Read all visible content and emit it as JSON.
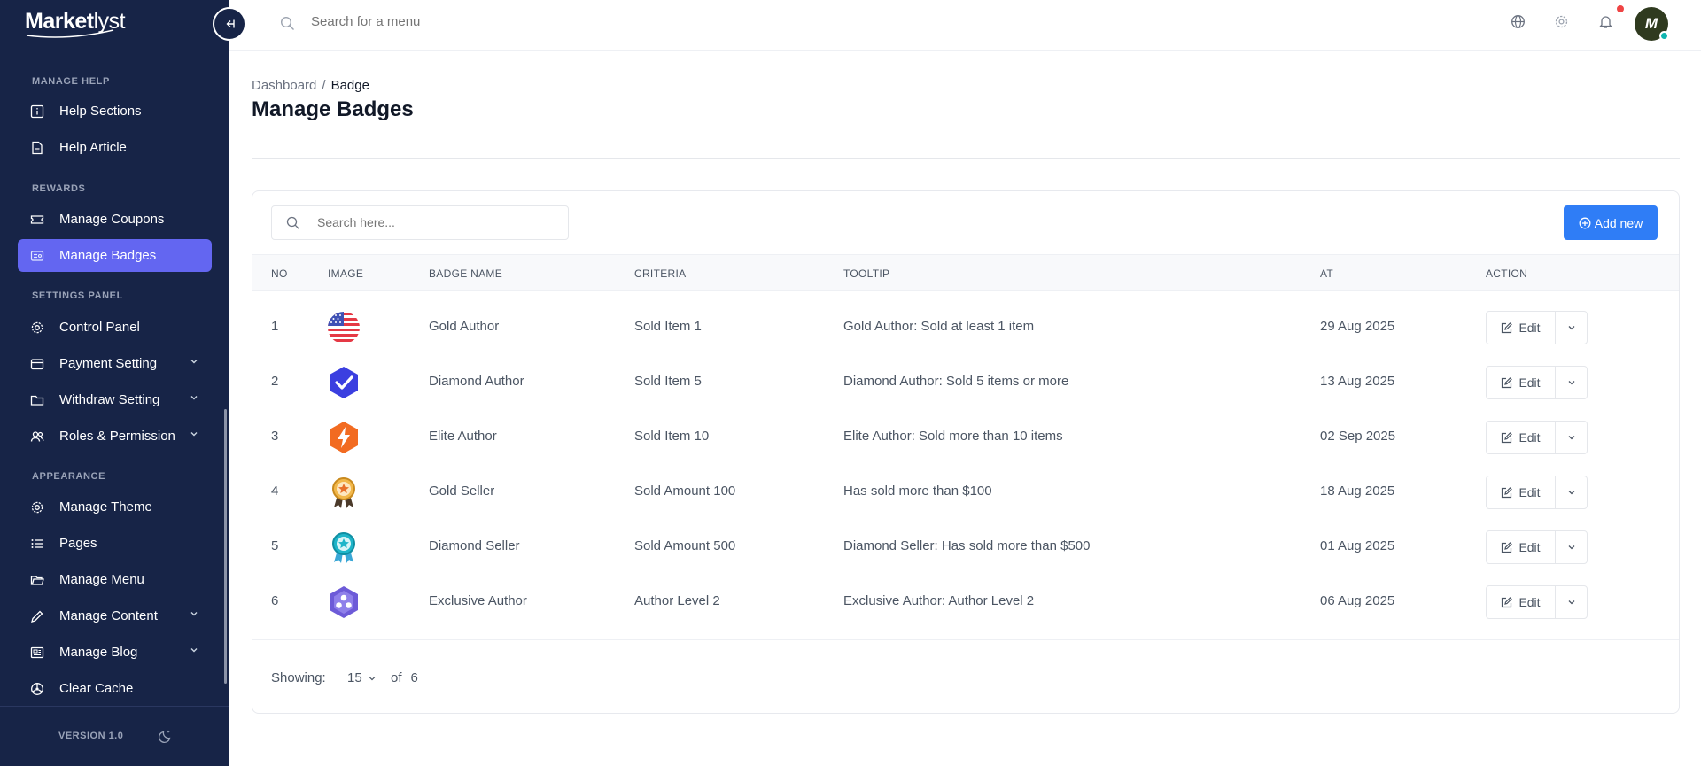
{
  "app": {
    "logo_bold": "Market",
    "logo_thin": "lyst"
  },
  "topbar": {
    "search_placeholder": "Search for a menu",
    "avatar_initial": "M"
  },
  "sidebar": {
    "sections": [
      {
        "title": "MANAGE HELP"
      },
      {
        "title": "REWARDS"
      },
      {
        "title": "SETTINGS PANEL"
      },
      {
        "title": "APPEARANCE"
      }
    ],
    "items": [
      {
        "label": "Help Sections",
        "icon": "info-square-icon"
      },
      {
        "label": "Help Article",
        "icon": "file-icon"
      },
      {
        "label": "Manage Coupons",
        "icon": "ticket-icon"
      },
      {
        "label": "Manage Badges",
        "icon": "badge-icon",
        "active": true
      },
      {
        "label": "Control Panel",
        "icon": "gear-icon"
      },
      {
        "label": "Payment Setting",
        "icon": "wallet-icon",
        "has_submenu": true
      },
      {
        "label": "Withdraw Setting",
        "icon": "folder-icon",
        "has_submenu": true
      },
      {
        "label": "Roles & Permission",
        "icon": "users-icon",
        "has_submenu": true
      },
      {
        "label": "Manage Theme",
        "icon": "gear-icon"
      },
      {
        "label": "Pages",
        "icon": "list-icon"
      },
      {
        "label": "Manage Menu",
        "icon": "folder-open-icon"
      },
      {
        "label": "Manage Content",
        "icon": "pen-icon",
        "has_submenu": true
      },
      {
        "label": "Manage Blog",
        "icon": "newspaper-icon",
        "has_submenu": true
      },
      {
        "label": "Clear Cache",
        "icon": "cache-icon"
      }
    ],
    "version": "VERSION 1.0"
  },
  "breadcrumb": {
    "parent": "Dashboard",
    "separator": "/",
    "current": "Badge"
  },
  "page": {
    "title": "Manage Badges"
  },
  "table": {
    "search_placeholder": "Search here...",
    "add_label": "Add new",
    "headers": {
      "no": "NO",
      "image": "IMAGE",
      "name": "BADGE NAME",
      "criteria": "CRITERIA",
      "tooltip": "TOOLTIP",
      "at": "AT",
      "action": "ACTION"
    },
    "edit_label": "Edit",
    "rows": [
      {
        "no": "1",
        "name": "Gold Author",
        "criteria": "Sold Item 1",
        "tooltip": "Gold Author: Sold at least 1 item",
        "at": "29 Aug 2025",
        "image": "us-flag-badge"
      },
      {
        "no": "2",
        "name": "Diamond Author",
        "criteria": "Sold Item 5",
        "tooltip": "Diamond Author: Sold 5 items or more",
        "at": "13 Aug 2025",
        "image": "blue-check-badge"
      },
      {
        "no": "3",
        "name": "Elite Author",
        "criteria": "Sold Item 10",
        "tooltip": "Elite Author: Sold more than 10 items",
        "at": "02 Sep 2025",
        "image": "orange-bolt-badge"
      },
      {
        "no": "4",
        "name": "Gold Seller",
        "criteria": "Sold Amount 100",
        "tooltip": "Has sold more than $100",
        "at": "18 Aug 2025",
        "image": "gold-medal-badge"
      },
      {
        "no": "5",
        "name": "Diamond Seller",
        "criteria": "Sold Amount 500",
        "tooltip": "Diamond Seller: Has sold more than $500",
        "at": "01 Aug 2025",
        "image": "teal-medal-badge"
      },
      {
        "no": "6",
        "name": "Exclusive Author",
        "criteria": "Author Level 2",
        "tooltip": "Exclusive Author: Author Level 2",
        "at": "06 Aug 2025",
        "image": "purple-hex-badge"
      }
    ],
    "footer": {
      "showing_label": "Showing:",
      "page_size": "15",
      "of_label": "of",
      "total": "6"
    }
  },
  "colors": {
    "sidebar_bg": "#172447",
    "active_item": "#6366f1",
    "primary_button": "#2f7df6"
  }
}
